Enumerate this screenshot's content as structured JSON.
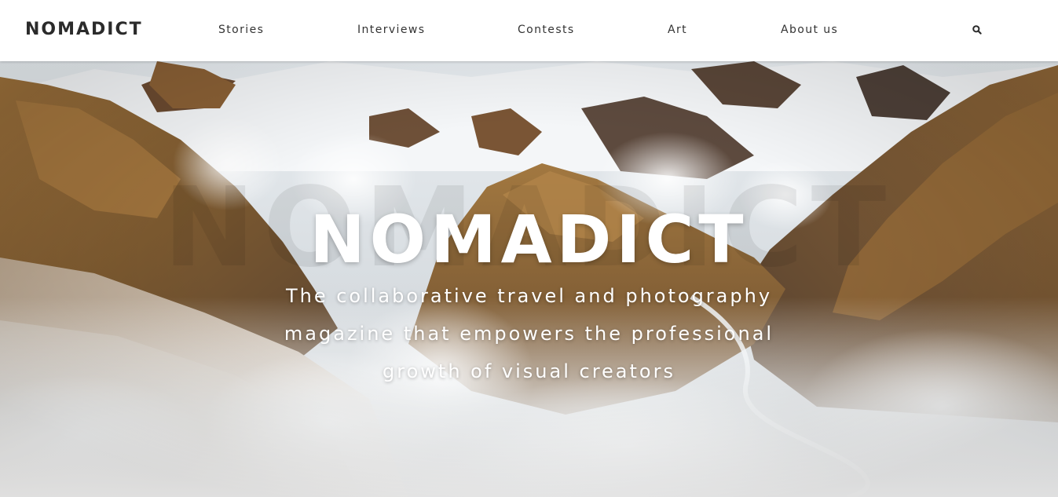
{
  "header": {
    "logo": "NOMADICT",
    "nav": [
      {
        "label": "Stories"
      },
      {
        "label": "Interviews"
      },
      {
        "label": "Contests"
      },
      {
        "label": "Art"
      },
      {
        "label": "About us"
      }
    ],
    "search_icon": "search-icon"
  },
  "hero": {
    "title": "NOMADICT",
    "subtitle": "The collaborative travel and photography magazine that empowers the professional growth of visual creators",
    "background": "aerial-photo-of-steaming-mountains-with-snow"
  },
  "colors": {
    "header_bg": "#ffffff",
    "text_dark": "#2b2b2b",
    "hero_text": "#ffffff",
    "snow": "#eef1f3",
    "rock_brown": "#8a6334",
    "rock_dark": "#4a3b30"
  }
}
